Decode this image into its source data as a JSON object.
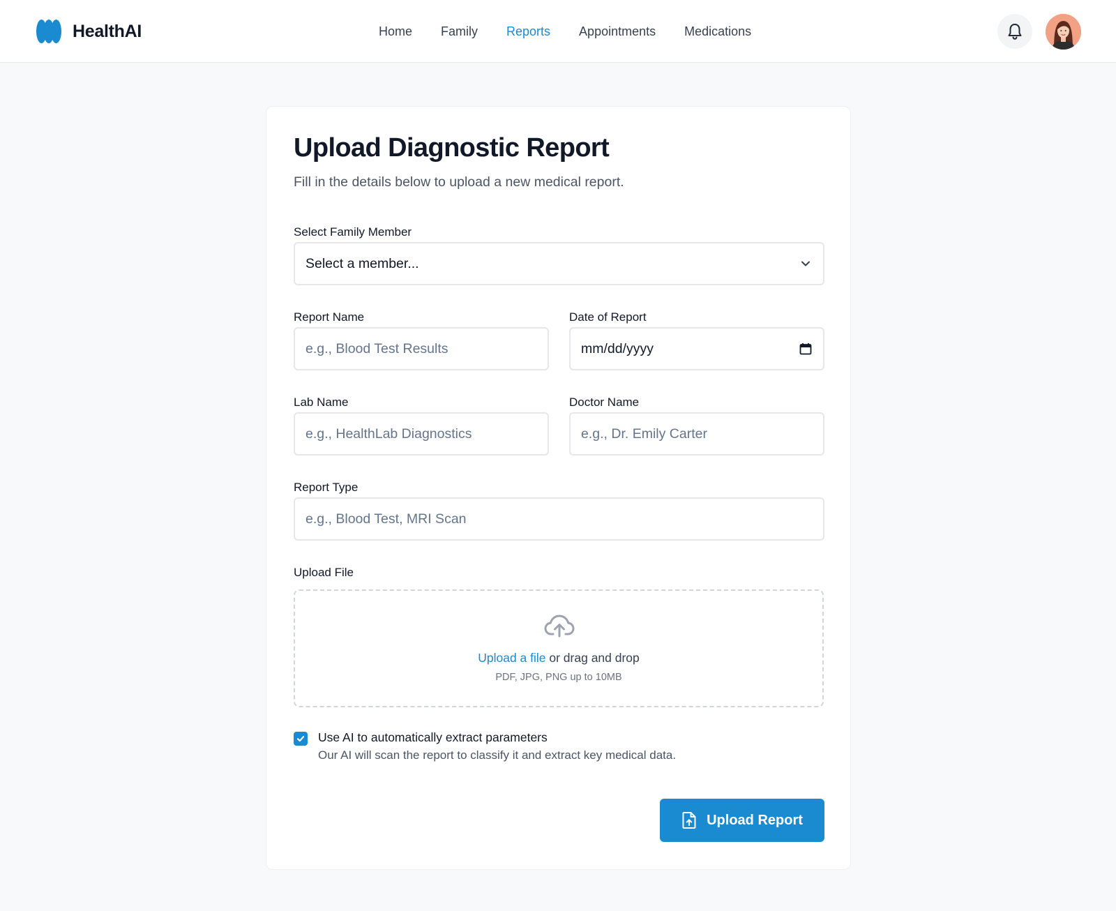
{
  "brand": {
    "name": "HealthAI",
    "logo_icon": "healthai-logo-icon",
    "color": "#1a8ad1"
  },
  "nav": {
    "items": [
      {
        "label": "Home",
        "active": false
      },
      {
        "label": "Family",
        "active": false
      },
      {
        "label": "Reports",
        "active": true
      },
      {
        "label": "Appointments",
        "active": false
      },
      {
        "label": "Medications",
        "active": false
      }
    ]
  },
  "header_actions": {
    "notifications_icon": "bell-icon",
    "avatar_icon": "user-avatar"
  },
  "form": {
    "title": "Upload Diagnostic Report",
    "subtitle": "Fill in the details below to upload a new medical report.",
    "family_member": {
      "label": "Select Family Member",
      "selected": "Select a member...",
      "icon": "chevron-down-icon"
    },
    "report_name": {
      "label": "Report Name",
      "placeholder": "e.g., Blood Test Results"
    },
    "report_date": {
      "label": "Date of Report",
      "value": "mm/dd/yyyy",
      "icon": "calendar-icon"
    },
    "lab_name": {
      "label": "Lab Name",
      "placeholder": "e.g., HealthLab Diagnostics"
    },
    "doctor_name": {
      "label": "Doctor Name",
      "placeholder": "e.g., Dr. Emily Carter"
    },
    "report_type": {
      "label": "Report Type",
      "placeholder": "e.g., Blood Test, MRI Scan"
    },
    "upload": {
      "label": "Upload File",
      "icon": "cloud-upload-icon",
      "link_text": "Upload a file",
      "rest_text": " or drag and drop",
      "hint": "PDF, JPG, PNG up to 10MB"
    },
    "ai_extract": {
      "checked": true,
      "label": "Use AI to automatically extract parameters",
      "help": "Our AI will scan the report to classify it and extract key medical data."
    },
    "submit": {
      "label": "Upload Report",
      "icon": "file-upload-icon"
    }
  },
  "colors": {
    "accent": "#1a8ad1",
    "page_bg": "#f8f9fa",
    "card_bg": "#ffffff",
    "placeholder": "#64748b"
  }
}
